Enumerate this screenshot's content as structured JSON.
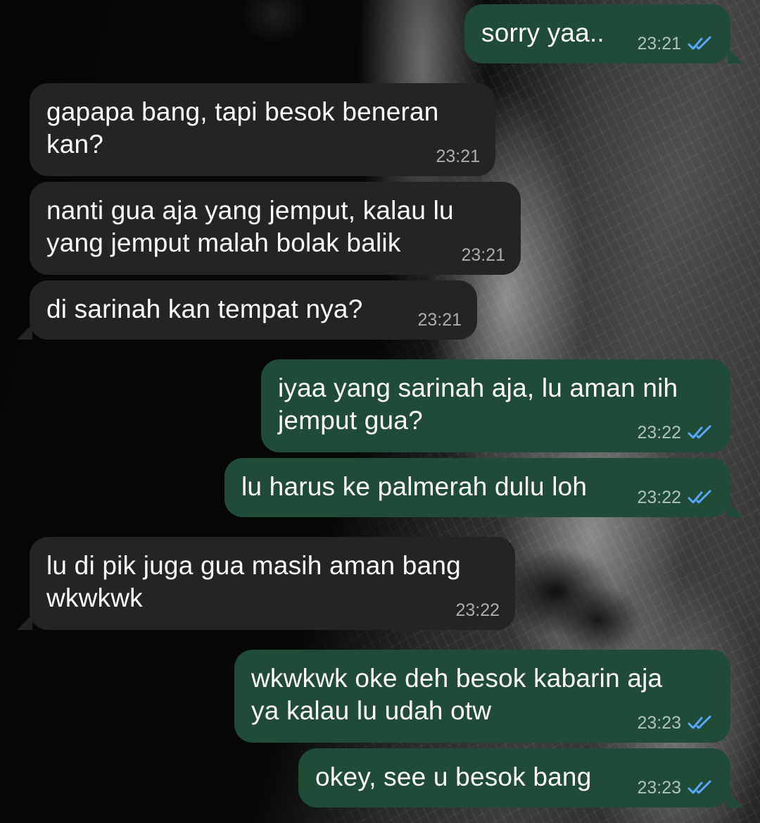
{
  "messages": [
    {
      "direction": "sent",
      "text": "sorry yaa..",
      "time": "23:21",
      "status_icon": "double-check-icon"
    },
    {
      "direction": "received",
      "text": "gapapa bang, tapi besok beneran\nkan?",
      "time": "23:21"
    },
    {
      "direction": "received",
      "text": "nanti gua aja yang jemput, kalau lu\nyang jemput malah bolak balik",
      "time": "23:21"
    },
    {
      "direction": "received",
      "text": "di sarinah kan tempat nya?",
      "time": "23:21"
    },
    {
      "direction": "sent",
      "text": "iyaa yang sarinah aja, lu aman nih\njemput gua?",
      "time": "23:22",
      "status_icon": "double-check-icon"
    },
    {
      "direction": "sent",
      "text": "lu harus ke palmerah dulu loh",
      "time": "23:22",
      "status_icon": "double-check-icon"
    },
    {
      "direction": "received",
      "text": "lu di pik juga gua masih aman bang\nwkwkwk",
      "time": "23:22"
    },
    {
      "direction": "sent",
      "text": "wkwkwk oke deh besok kabarin aja\nya kalau lu udah otw",
      "time": "23:23",
      "status_icon": "double-check-icon"
    },
    {
      "direction": "sent",
      "text": "okey, see u besok bang",
      "time": "23:23",
      "status_icon": "double-check-icon"
    }
  ],
  "colors": {
    "sent_bubble": "#204b37",
    "received_bubble": "#232524",
    "read_check": "#5aa7ff"
  }
}
